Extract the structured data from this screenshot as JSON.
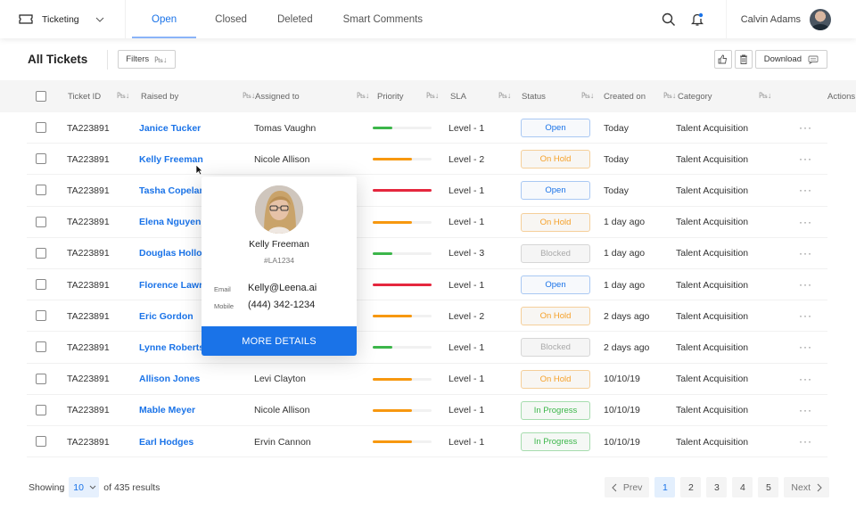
{
  "topbar": {
    "app_name": "Ticketing",
    "tabs": [
      {
        "label": "Open",
        "active": true
      },
      {
        "label": "Closed",
        "active": false
      },
      {
        "label": "Deleted",
        "active": false
      },
      {
        "label": "Smart Comments",
        "active": false
      }
    ],
    "user_name": "Calvin Adams",
    "notification_dot": true
  },
  "toolbar": {
    "title": "All Tickets",
    "filters_label": "Filters",
    "download_label": "Download"
  },
  "table": {
    "columns": [
      "Ticket ID",
      "Raised by",
      "Assigned to",
      "Priority",
      "SLA",
      "Status",
      "Created on",
      "Category",
      "Actions"
    ],
    "rows": [
      {
        "id": "TA223891",
        "raised_by": "Janice Tucker",
        "assigned_to": "Tomas Vaughn",
        "priority": "low",
        "priority_pct": 33,
        "sla": "Level - 1",
        "status": "Open",
        "created": "Today",
        "category": "Talent Acquisition"
      },
      {
        "id": "TA223891",
        "raised_by": "Kelly Freeman",
        "assigned_to": "Nicole Allison",
        "priority": "medium",
        "priority_pct": 67,
        "sla": "Level - 2",
        "status": "On Hold",
        "created": "Today",
        "category": "Talent Acquisition"
      },
      {
        "id": "TA223891",
        "raised_by": "Tasha Copeland",
        "assigned_to": "",
        "priority": "high",
        "priority_pct": 100,
        "sla": "Level - 1",
        "status": "Open",
        "created": "Today",
        "category": "Talent Acquisition"
      },
      {
        "id": "TA223891",
        "raised_by": "Elena Nguyen",
        "assigned_to": "",
        "priority": "medium",
        "priority_pct": 67,
        "sla": "Level - 1",
        "status": "On Hold",
        "created": "1 day ago",
        "category": "Talent Acquisition"
      },
      {
        "id": "TA223891",
        "raised_by": "Douglas Holloway",
        "assigned_to": "",
        "priority": "low",
        "priority_pct": 33,
        "sla": "Level - 3",
        "status": "Blocked",
        "created": "1 day ago",
        "category": "Talent Acquisition"
      },
      {
        "id": "TA223891",
        "raised_by": "Florence Lawrence",
        "assigned_to": "",
        "priority": "high",
        "priority_pct": 100,
        "sla": "Level - 1",
        "status": "Open",
        "created": "1 day ago",
        "category": "Talent Acquisition"
      },
      {
        "id": "TA223891",
        "raised_by": "Eric Gordon",
        "assigned_to": "",
        "priority": "medium",
        "priority_pct": 67,
        "sla": "Level - 2",
        "status": "On Hold",
        "created": "2 days ago",
        "category": "Talent Acquisition"
      },
      {
        "id": "TA223891",
        "raised_by": "Lynne Roberts",
        "assigned_to": "",
        "priority": "low",
        "priority_pct": 33,
        "sla": "Level - 1",
        "status": "Blocked",
        "created": "2 days ago",
        "category": "Talent Acquisition"
      },
      {
        "id": "TA223891",
        "raised_by": "Allison Jones",
        "assigned_to": "Levi Clayton",
        "priority": "medium",
        "priority_pct": 67,
        "sla": "Level - 1",
        "status": "On Hold",
        "created": "10/10/19",
        "category": "Talent Acquisition"
      },
      {
        "id": "TA223891",
        "raised_by": "Mable Meyer",
        "assigned_to": "Nicole Allison",
        "priority": "medium",
        "priority_pct": 67,
        "sla": "Level - 1",
        "status": "In Progress",
        "created": "10/10/19",
        "category": "Talent Acquisition"
      },
      {
        "id": "TA223891",
        "raised_by": "Earl Hodges",
        "assigned_to": "Ervin Cannon",
        "priority": "medium",
        "priority_pct": 67,
        "sla": "Level - 1",
        "status": "In Progress",
        "created": "10/10/19",
        "category": "Talent Acquisition"
      }
    ],
    "actions_glyph": "···"
  },
  "priority_colors": {
    "low": "#3cb64a",
    "medium": "#f7980f",
    "high": "#e5273e"
  },
  "status_styles": {
    "Open": {
      "color": "#1a73e8",
      "border": "#a9c8f3",
      "bg": "#f7f9fc"
    },
    "On Hold": {
      "color": "#f5a028",
      "border": "#f5cf9a",
      "bg": "#f8f6f3"
    },
    "Blocked": {
      "color": "#a9a9a9",
      "border": "#d6d6d6",
      "bg": "#f5f5f5"
    },
    "In Progress": {
      "color": "#3cb64a",
      "border": "#a6dcae",
      "bg": "#f5f8f5"
    }
  },
  "popover": {
    "name": "Kelly Freeman",
    "employee_id": "#LA1234",
    "email_label": "Email",
    "email": "Kelly@Leena.ai",
    "mobile_label": "Mobile",
    "mobile": "(444) 342-1234",
    "button_label": "MORE DETAILS"
  },
  "footer": {
    "showing_label": "Showing",
    "page_size": "10",
    "results_label": "of 435 results",
    "prev_label": "Prev",
    "next_label": "Next",
    "pages": [
      "1",
      "2",
      "3",
      "4",
      "5"
    ],
    "current_page": "1"
  }
}
